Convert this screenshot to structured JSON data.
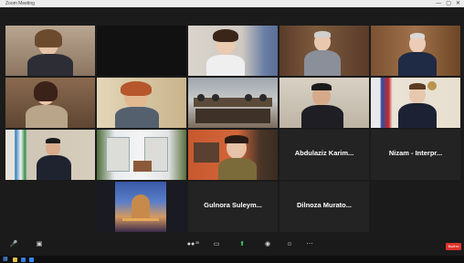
{
  "window": {
    "title": "Zoom Meeting",
    "minimize_glyph": "—",
    "maximize_glyph": "▢",
    "close_glyph": "✕"
  },
  "tiles": [
    {
      "name": "",
      "big_name": ""
    },
    {
      "name": "",
      "big_name": ""
    },
    {
      "name": "",
      "big_name": ""
    },
    {
      "name": "",
      "big_name": ""
    },
    {
      "name": "",
      "big_name": ""
    },
    {
      "name": "",
      "big_name": ""
    },
    {
      "name": "",
      "big_name": ""
    },
    {
      "name": "",
      "big_name": ""
    },
    {
      "name": "",
      "big_name": ""
    },
    {
      "name": "",
      "big_name": ""
    },
    {
      "name": "",
      "big_name": ""
    },
    {
      "name": "",
      "big_name": ""
    },
    {
      "name": "",
      "big_name": "Abdulaziz Karim..."
    },
    {
      "name": "",
      "big_name": "Nizam - Interpr..."
    },
    {
      "name": "",
      "big_name": ""
    },
    {
      "name": "",
      "big_name": "Gulnora Suleym..."
    },
    {
      "name": "",
      "big_name": "Dilnoza Murato..."
    }
  ],
  "toolbar": {
    "participants_count": "20",
    "end_label": "Выйти"
  },
  "colors": {
    "active_border": "#e6e14a",
    "end_button": "#e0322a"
  },
  "icons": [
    "microphone-icon",
    "video-camera-icon",
    "participants-icon",
    "chat-icon",
    "share-screen-icon",
    "record-icon",
    "reactions-icon",
    "windows-start-icon"
  ]
}
